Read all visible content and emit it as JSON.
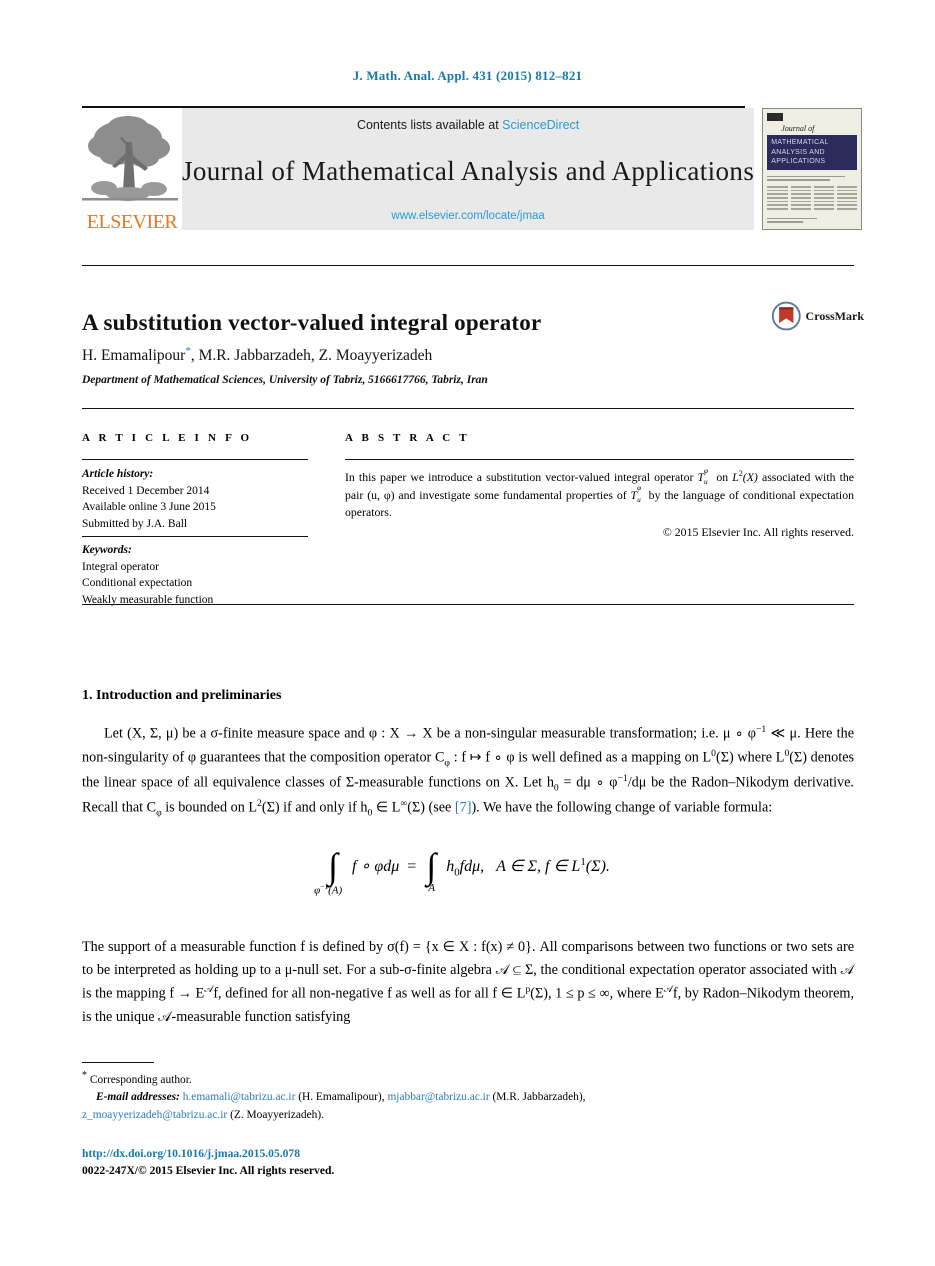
{
  "running_head": "J. Math. Anal. Appl. 431 (2015) 812–821",
  "masthead": {
    "contents_prefix": "Contents lists available at",
    "sciencedirect": "ScienceDirect",
    "journal_title": "Journal of Mathematical Analysis and Applications",
    "journal_url": "www.elsevier.com/locate/jmaa",
    "publisher_wordmark": "ELSEVIER",
    "cover": {
      "journal_of": "Journal of",
      "band_title": "MATHEMATICAL ANALYSIS AND APPLICATIONS"
    }
  },
  "article": {
    "title": "A substitution vector-valued integral operator",
    "authors": "H. Emamalipour",
    "author_marker": "*",
    "authors_rest": ", M.R. Jabbarzadeh, Z. Moayyerizadeh",
    "affiliation": "Department of Mathematical Sciences, University of Tabriz, 5166617766, Tabriz, Iran",
    "crossmark_label": "CrossMark"
  },
  "info": {
    "article_info_header": "A R T I C L E   I N F O",
    "abstract_header": "A B S T R A C T",
    "history_label": "Article history:",
    "history": [
      "Received 1 December 2014",
      "Available online 3 June 2015",
      "Submitted by J.A. Ball"
    ],
    "keywords_label": "Keywords:",
    "keywords": [
      "Integral operator",
      "Conditional expectation",
      "Weakly measurable function"
    ]
  },
  "abstract": {
    "part1": "In this paper we introduce a substitution vector-valued integral operator",
    "op1": "T",
    "op1_sub": "u",
    "op1_sup": "φ",
    "part2": "on",
    "space": "L",
    "space_sup": "2",
    "space_arg": "(X)",
    "part3": "associated with the pair (u, φ) and investigate some fundamental properties of",
    "op2": "T",
    "op2_sub": "u",
    "op2_sup": "φ",
    "part4": "by the language of conditional expectation operators.",
    "copyright": "© 2015 Elsevier Inc. All rights reserved."
  },
  "section": {
    "heading": "1. Introduction and preliminaries"
  },
  "body": {
    "p1_a": "Let (X, Σ, μ) be a σ-finite measure space and φ : X → X be a non-singular measurable transformation; i.e. μ ∘ φ",
    "p1_b": "−1",
    "p1_c": " ≪ μ. Here the non-singularity of φ guarantees that the composition operator C",
    "p1_d": "φ",
    "p1_e": " : f ↦ f ∘ φ is well defined as a mapping on L",
    "p1_f": "0",
    "p1_g": "(Σ) where L",
    "p1_h": "0",
    "p1_i": "(Σ) denotes the linear space of all equivalence classes of Σ-measurable functions on X. Let h",
    "p1_j": "0",
    "p1_k": " = dμ ∘ φ",
    "p1_l": "−1",
    "p1_m": "/dμ be the Radon–Nikodym derivative. Recall that C",
    "p1_n": "φ",
    "p1_o": " is bounded on L",
    "p1_p": "2",
    "p1_q": "(Σ) if and only if h",
    "p1_r": "0",
    "p1_s": " ∈ L",
    "p1_t": "∞",
    "p1_u": "(Σ) (see ",
    "citation": "[7]",
    "p1_v": "). We have the following change of variable formula:",
    "p2_a": "The support of a measurable function f is defined by σ(f) = {x ∈ X : f(x) ≠ 0}. All comparisons between two functions or two sets are to be interpreted as holding up to a μ-null set. For a sub-σ-finite algebra 𝒜 ⊆ Σ, the conditional expectation operator associated with 𝒜 is the mapping f → E",
    "p2_sup": "𝒜",
    "p2_b": "f, defined for all non-negative f as well as for all f ∈ L",
    "p2_sup2": "p",
    "p2_c": "(Σ), 1 ≤ p ≤ ∞, where E",
    "p2_sup3": "𝒜",
    "p2_d": "f, by Radon–Nikodym theorem, is the unique 𝒜-measurable function satisfying"
  },
  "equation": {
    "lower_limit_1": "φ",
    "lower_limit_1_sup": "−1",
    "lower_limit_1_arg": "(A)",
    "integrand_1": "f ∘ φdμ",
    "equals": "=",
    "lower_limit_2": "A",
    "integrand_2": "h",
    "integrand_2_sub": "0",
    "integrand_2_rest": "fdμ,",
    "conditions": "A ∈ Σ,  f ∈ L",
    "conditions_sup": "1",
    "conditions_end": "(Σ)."
  },
  "footnotes": {
    "corresponding_marker": "*",
    "corresponding": "Corresponding author.",
    "email_label": "E-mail addresses:",
    "emails": [
      {
        "address": "h.emamali@tabrizu.ac.ir",
        "name": "(H. Emamalipour),"
      },
      {
        "address": "mjabbar@tabrizu.ac.ir",
        "name": "(M.R. Jabbarzadeh),"
      },
      {
        "address": "z_moayyerizadeh@tabrizu.ac.ir",
        "name": "(Z. Moayyerizadeh)."
      }
    ],
    "doi": "http://dx.doi.org/10.1016/j.jmaa.2015.05.078",
    "issn_line": "0022-247X/© 2015 Elsevier Inc. All rights reserved."
  },
  "colors": {
    "link_blue": "#2b7bb9",
    "header_blue": "#1679a8",
    "elsevier_orange": "#e87722",
    "cover_navy": "#2d2a5c",
    "banner_gray": "#e9e9e9"
  }
}
